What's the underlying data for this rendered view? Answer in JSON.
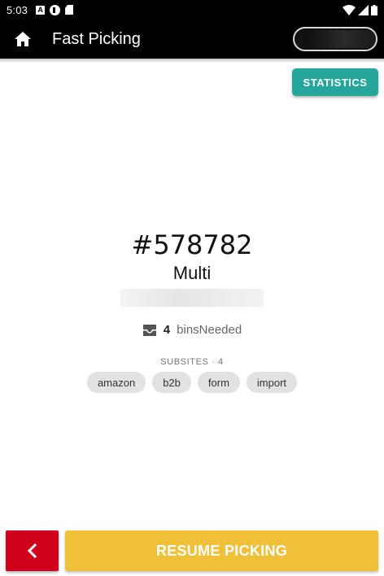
{
  "status_bar": {
    "time": "5:03",
    "notif_a_label": "A"
  },
  "app_bar": {
    "title": "Fast Picking",
    "home_icon": "home-icon"
  },
  "actions": {
    "statistics_label": "STATISTICS",
    "resume_label": "RESUME PICKING",
    "back_icon": "chevron-left-icon"
  },
  "order": {
    "number": "#578782",
    "type": "Multi",
    "bins_count": "4",
    "bins_label": "binsNeeded",
    "bins_icon": "inbox-tray-icon"
  },
  "subsites": {
    "header": "SUBSITES · 4",
    "items": [
      "amazon",
      "b2b",
      "form",
      "import"
    ]
  },
  "colors": {
    "statistics": "#26a69a",
    "resume": "#f0c038",
    "back": "#d0021b",
    "app_bar": "#000000"
  }
}
